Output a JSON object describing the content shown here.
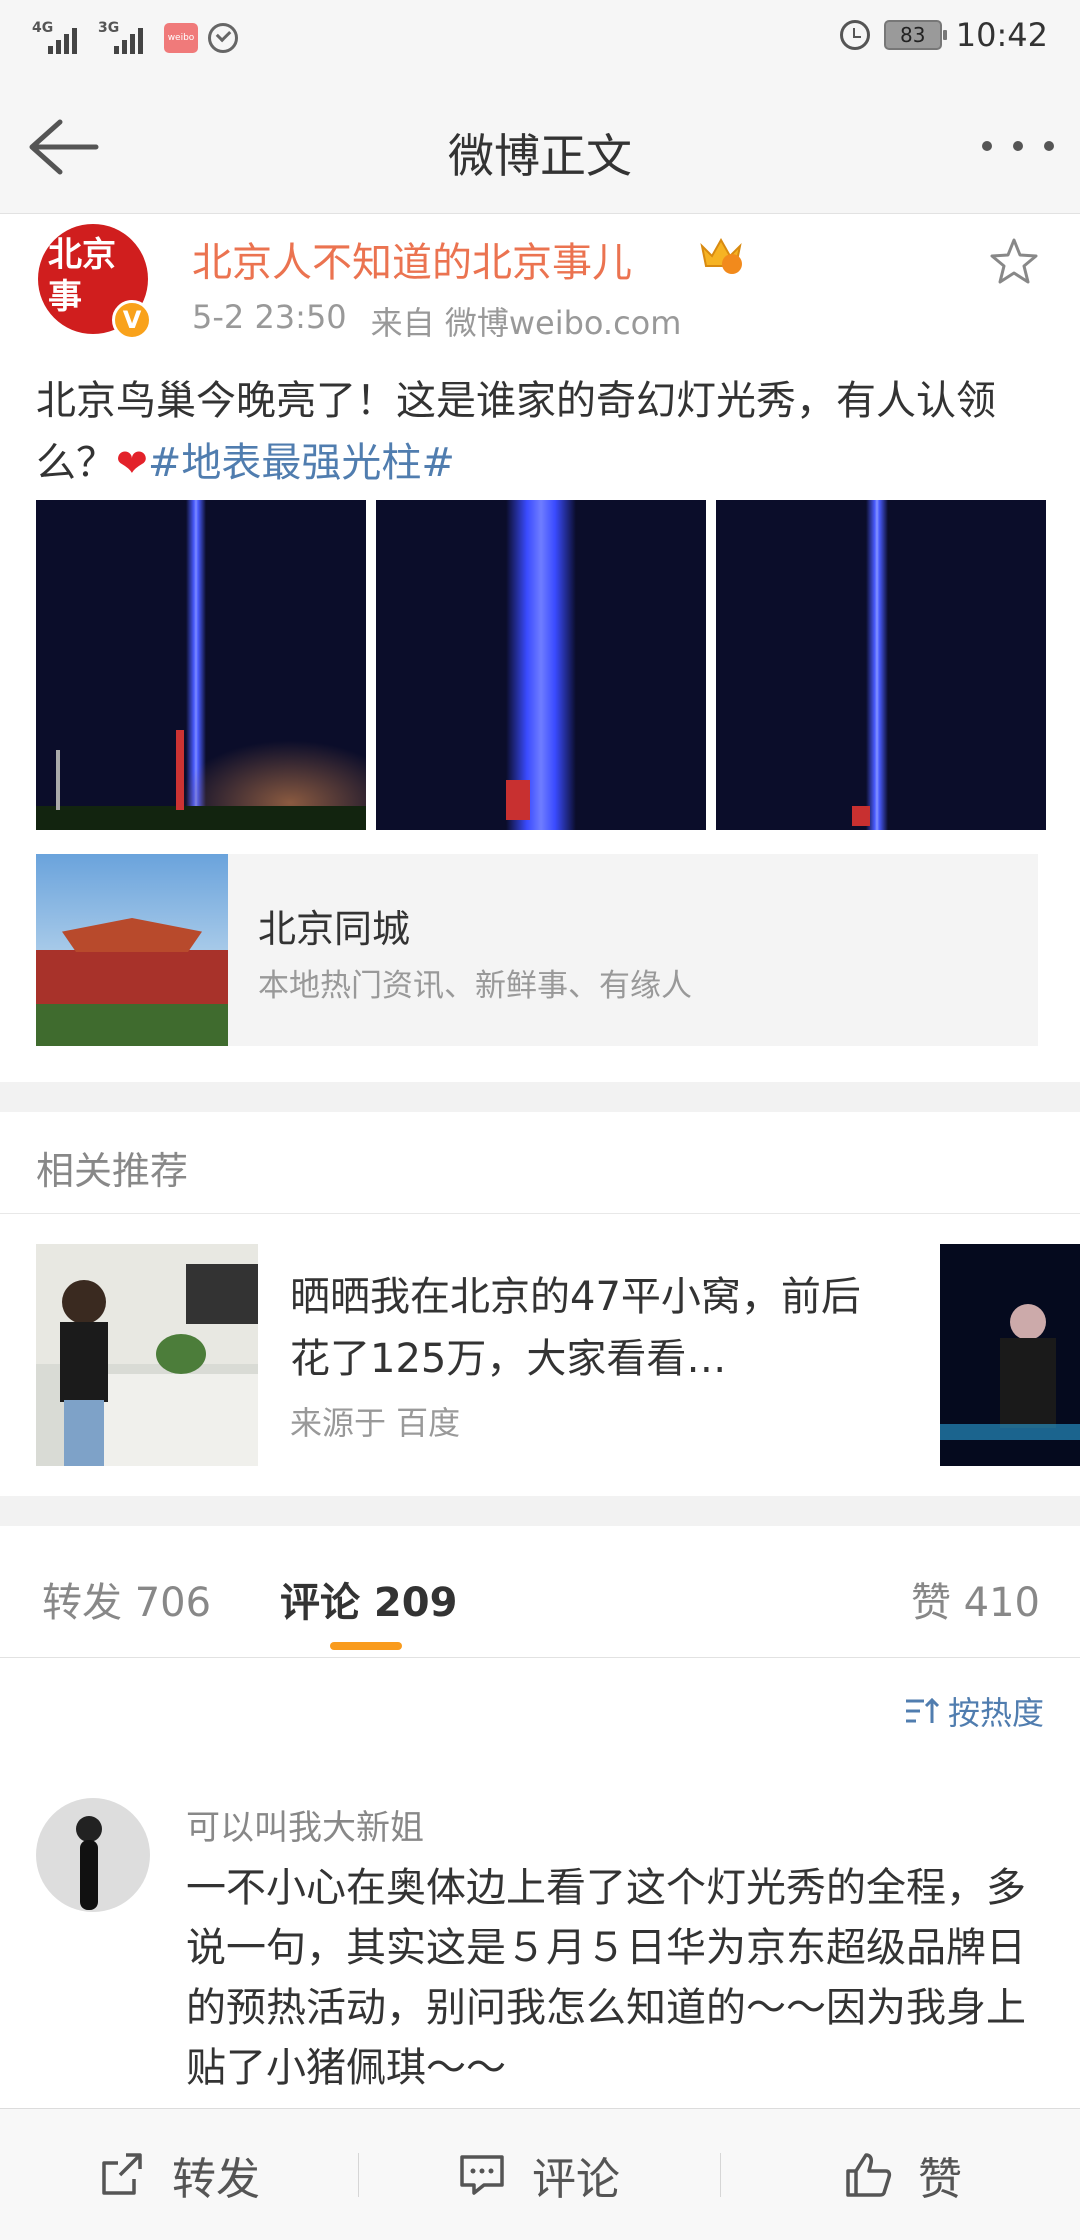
{
  "status_bar": {
    "signal1_tag": "4G",
    "signal2_tag": "3G",
    "app_badge": "weibo",
    "battery": "83",
    "time": "10:42"
  },
  "header": {
    "title": "微博正文"
  },
  "post": {
    "user_name": "北京人不知道的北京事儿",
    "avatar_text": "北京事",
    "verified_badge": "V",
    "time": "5-2 23:50",
    "source": "来自 微博weibo.com",
    "text": "北京鸟巢今晚亮了！这是谁家的奇幻灯光秀，有人认领么？",
    "hashtag": "#地表最强光柱#",
    "link_card": {
      "title": "北京同城",
      "description": "本地热门资讯、新鲜事、有缘人"
    }
  },
  "related": {
    "title": "相关推荐",
    "item": {
      "text": "晒晒我在北京的47平小窝，前后花了125万，大家看看…",
      "source": "来源于 百度"
    }
  },
  "tabs": {
    "repost": "转发 706",
    "comment": "评论 209",
    "like": "赞 410"
  },
  "comments": {
    "sort_label": "按热度",
    "items": [
      {
        "user": "可以叫我大新姐",
        "text": "一不小心在奥体边上看了这个灯光秀的全程，多说一句，其实这是５月５日华为京东超级品牌日的预热活动，别问我怎么知道的～～因为我身上贴了小猪佩琪～～"
      }
    ]
  },
  "bottom_bar": {
    "repost": "转发",
    "comment": "评论",
    "like": "赞"
  },
  "colors": {
    "username_orange": "#eb7350",
    "link_blue": "#507daf",
    "tab_underline": "#f99b1d"
  }
}
